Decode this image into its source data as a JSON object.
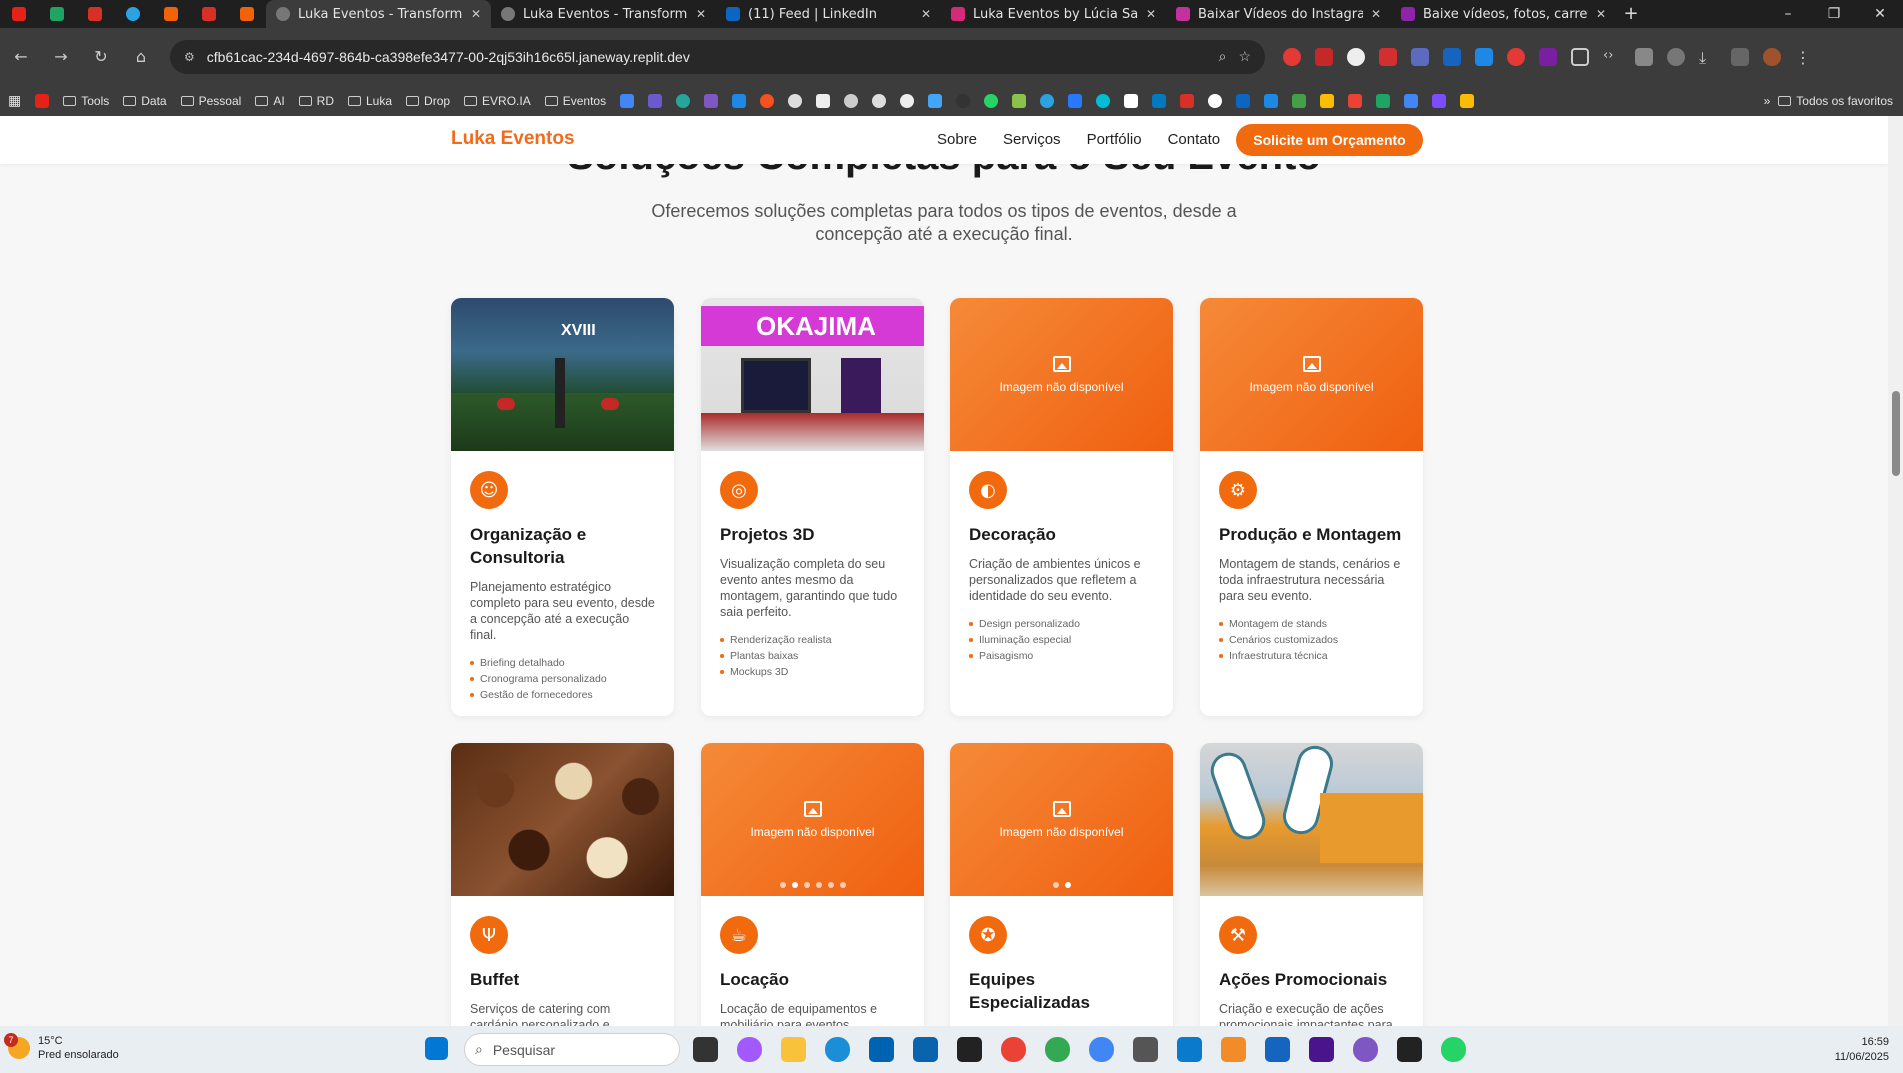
{
  "browser": {
    "tabs": [
      {
        "label": "Luka Eventos - Transformando",
        "active": true
      },
      {
        "label": "Luka Eventos - Transformando",
        "active": false
      },
      {
        "label": "(11) Feed | LinkedIn",
        "active": false
      },
      {
        "label": "Luka Eventos by Lúcia Salgado",
        "active": false
      },
      {
        "label": "Baixar Vídeos do Instagram",
        "active": false
      },
      {
        "label": "Baixe vídeos, fotos, carretéis",
        "active": false
      }
    ],
    "url": "cfb61cac-234d-4697-864b-ca398efe3477-00-2qj53ih16c65l.janeway.replit.dev",
    "bookmarks": [
      "Tools",
      "Data",
      "Pessoal",
      "AI",
      "RD",
      "Luka",
      "Drop",
      "EVRO.IA",
      "Eventos"
    ],
    "bookmarks_right": "Todos os favoritos"
  },
  "site": {
    "brand": "Luka Eventos",
    "menu": [
      "Sobre",
      "Serviços",
      "Portfólio",
      "Contato"
    ],
    "cta": "Solicite um Orçamento",
    "heading": "Soluções Completas para o Seu Evento",
    "subtitle": "Oferecemos soluções completas para todos os tipos de eventos, desde a concepção até a execução final.",
    "image_unavailable": "Imagem não disponível",
    "accent_color": "#f26a0e"
  },
  "services": [
    {
      "title": "Organização e Consultoria",
      "icon": "users-icon",
      "desc": "Planejamento estratégico completo para seu evento, desde a concepção até a execução final.",
      "items": [
        "Briefing detalhado",
        "Cronograma personalizado",
        "Gestão de fornecedores"
      ]
    },
    {
      "title": "Projetos 3D",
      "icon": "target-icon",
      "desc": "Visualização completa do seu evento antes mesmo da montagem, garantindo que tudo saia perfeito.",
      "items": [
        "Renderização realista",
        "Plantas baixas",
        "Mockups 3D"
      ]
    },
    {
      "title": "Decoração",
      "icon": "palette-icon",
      "desc": "Criação de ambientes únicos e personalizados que refletem a identidade do seu evento.",
      "items": [
        "Design personalizado",
        "Iluminação especial",
        "Paisagismo"
      ]
    },
    {
      "title": "Produção e Montagem",
      "icon": "gear-icon",
      "desc": "Montagem de stands, cenários e toda infraestrutura necessária para seu evento.",
      "items": [
        "Montagem de stands",
        "Cenários customizados",
        "Infraestrutura técnica"
      ]
    },
    {
      "title": "Buffet",
      "icon": "utensils-icon",
      "desc": "Serviços de catering com cardápio personalizado e"
    },
    {
      "title": "Locação",
      "icon": "coffee-icon",
      "desc": "Locação de equipamentos e mobiliário para eventos"
    },
    {
      "title": "Equipes Especializadas",
      "icon": "award-icon",
      "desc": ""
    },
    {
      "title": "Ações Promocionais",
      "icon": "hammer-icon",
      "desc": "Criação e execução de ações promocionais impactantes para"
    }
  ],
  "congress_sign": "XVIII",
  "okajima_sign": "OKAJIMA",
  "taskbar": {
    "weather_temp": "15°C",
    "weather_desc": "Pred ensolarado",
    "weather_badge": "7",
    "search_placeholder": "Pesquisar",
    "time": "16:59",
    "date": "11/06/2025"
  }
}
